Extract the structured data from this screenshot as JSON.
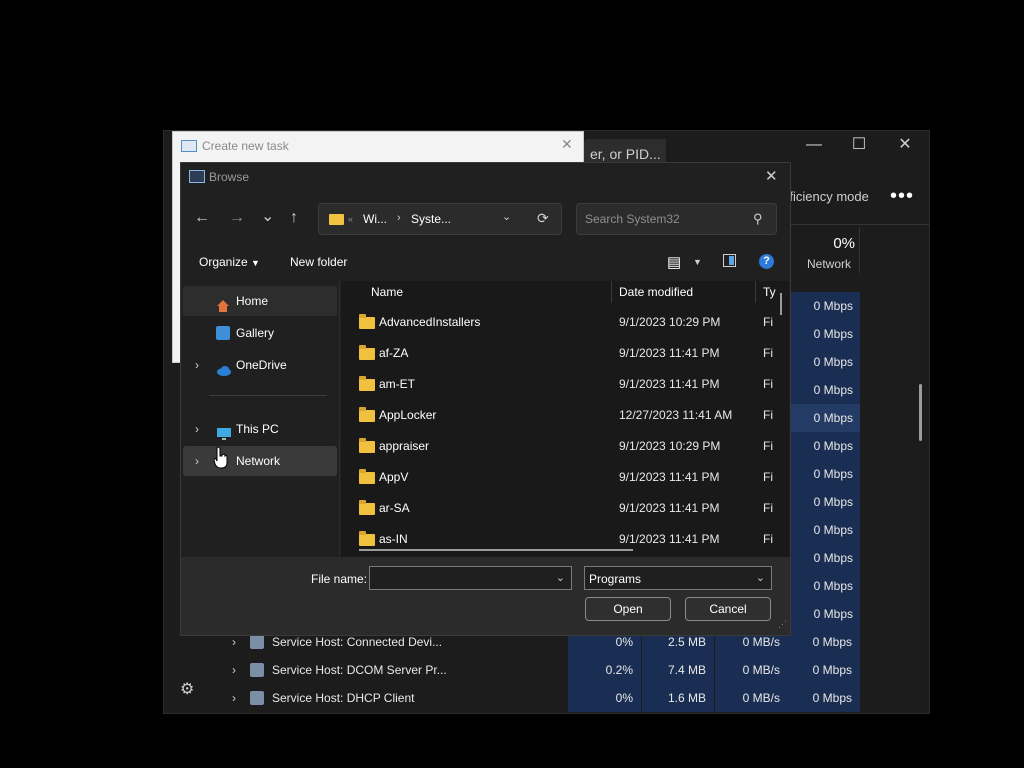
{
  "task_manager": {
    "search_placeholder": "er, or PID...",
    "minimize": "—",
    "maximize": "☐",
    "close": "✕",
    "efficiency_mode": "fficiency mode",
    "more": "•••",
    "network_pct": "0%",
    "network_label": "Network",
    "network_col": [
      "0 Mbps",
      "0 Mbps",
      "0 Mbps",
      "0 Mbps",
      "0 Mbps",
      "0 Mbps",
      "0 Mbps",
      "0 Mbps",
      "0 Mbps",
      "0 Mbps",
      "0 Mbps",
      "0 Mbps"
    ],
    "processes": [
      {
        "name": "Service Host: Connected Devi...",
        "cpu": "0%",
        "mem": "2.5 MB",
        "disk": "0 MB/s",
        "net": "0 Mbps"
      },
      {
        "name": "Service Host: DCOM Server Pr...",
        "cpu": "0.2%",
        "mem": "7.4 MB",
        "disk": "0 MB/s",
        "net": "0 Mbps"
      },
      {
        "name": "Service Host: DHCP Client",
        "cpu": "0%",
        "mem": "1.6 MB",
        "disk": "0 MB/s",
        "net": "0 Mbps"
      }
    ]
  },
  "create_task": {
    "title": "Create new task",
    "close": "✕"
  },
  "browse": {
    "title": "Browse",
    "close": "✕",
    "nav": {
      "back": "←",
      "forward": "→",
      "recent": "⌄",
      "up": "↑"
    },
    "address": {
      "seg1": "Wi...",
      "seg2": "Syste...",
      "sep": "›",
      "overflow": "«",
      "refresh": "⟳"
    },
    "search_placeholder": "Search System32",
    "commands": {
      "organize": "Organize",
      "new_folder": "New folder"
    },
    "nav_items": [
      {
        "label": "Home"
      },
      {
        "label": "Gallery"
      },
      {
        "label": "OneDrive"
      },
      {
        "label": "This PC"
      },
      {
        "label": "Network"
      }
    ],
    "columns": {
      "name": "Name",
      "date": "Date modified",
      "type": "Ty"
    },
    "files": [
      {
        "name": "AdvancedInstallers",
        "date": "9/1/2023 10:29 PM",
        "type": "Fi"
      },
      {
        "name": "af-ZA",
        "date": "9/1/2023 11:41 PM",
        "type": "Fi"
      },
      {
        "name": "am-ET",
        "date": "9/1/2023 11:41 PM",
        "type": "Fi"
      },
      {
        "name": "AppLocker",
        "date": "12/27/2023 11:41 AM",
        "type": "Fi"
      },
      {
        "name": "appraiser",
        "date": "9/1/2023 10:29 PM",
        "type": "Fi"
      },
      {
        "name": "AppV",
        "date": "9/1/2023 11:41 PM",
        "type": "Fi"
      },
      {
        "name": "ar-SA",
        "date": "9/1/2023 11:41 PM",
        "type": "Fi"
      },
      {
        "name": "as-IN",
        "date": "9/1/2023 11:41 PM",
        "type": "Fi"
      }
    ],
    "file_name_label": "File name:",
    "file_name_value": "",
    "file_type": "Programs",
    "open": "Open",
    "cancel": "Cancel"
  }
}
